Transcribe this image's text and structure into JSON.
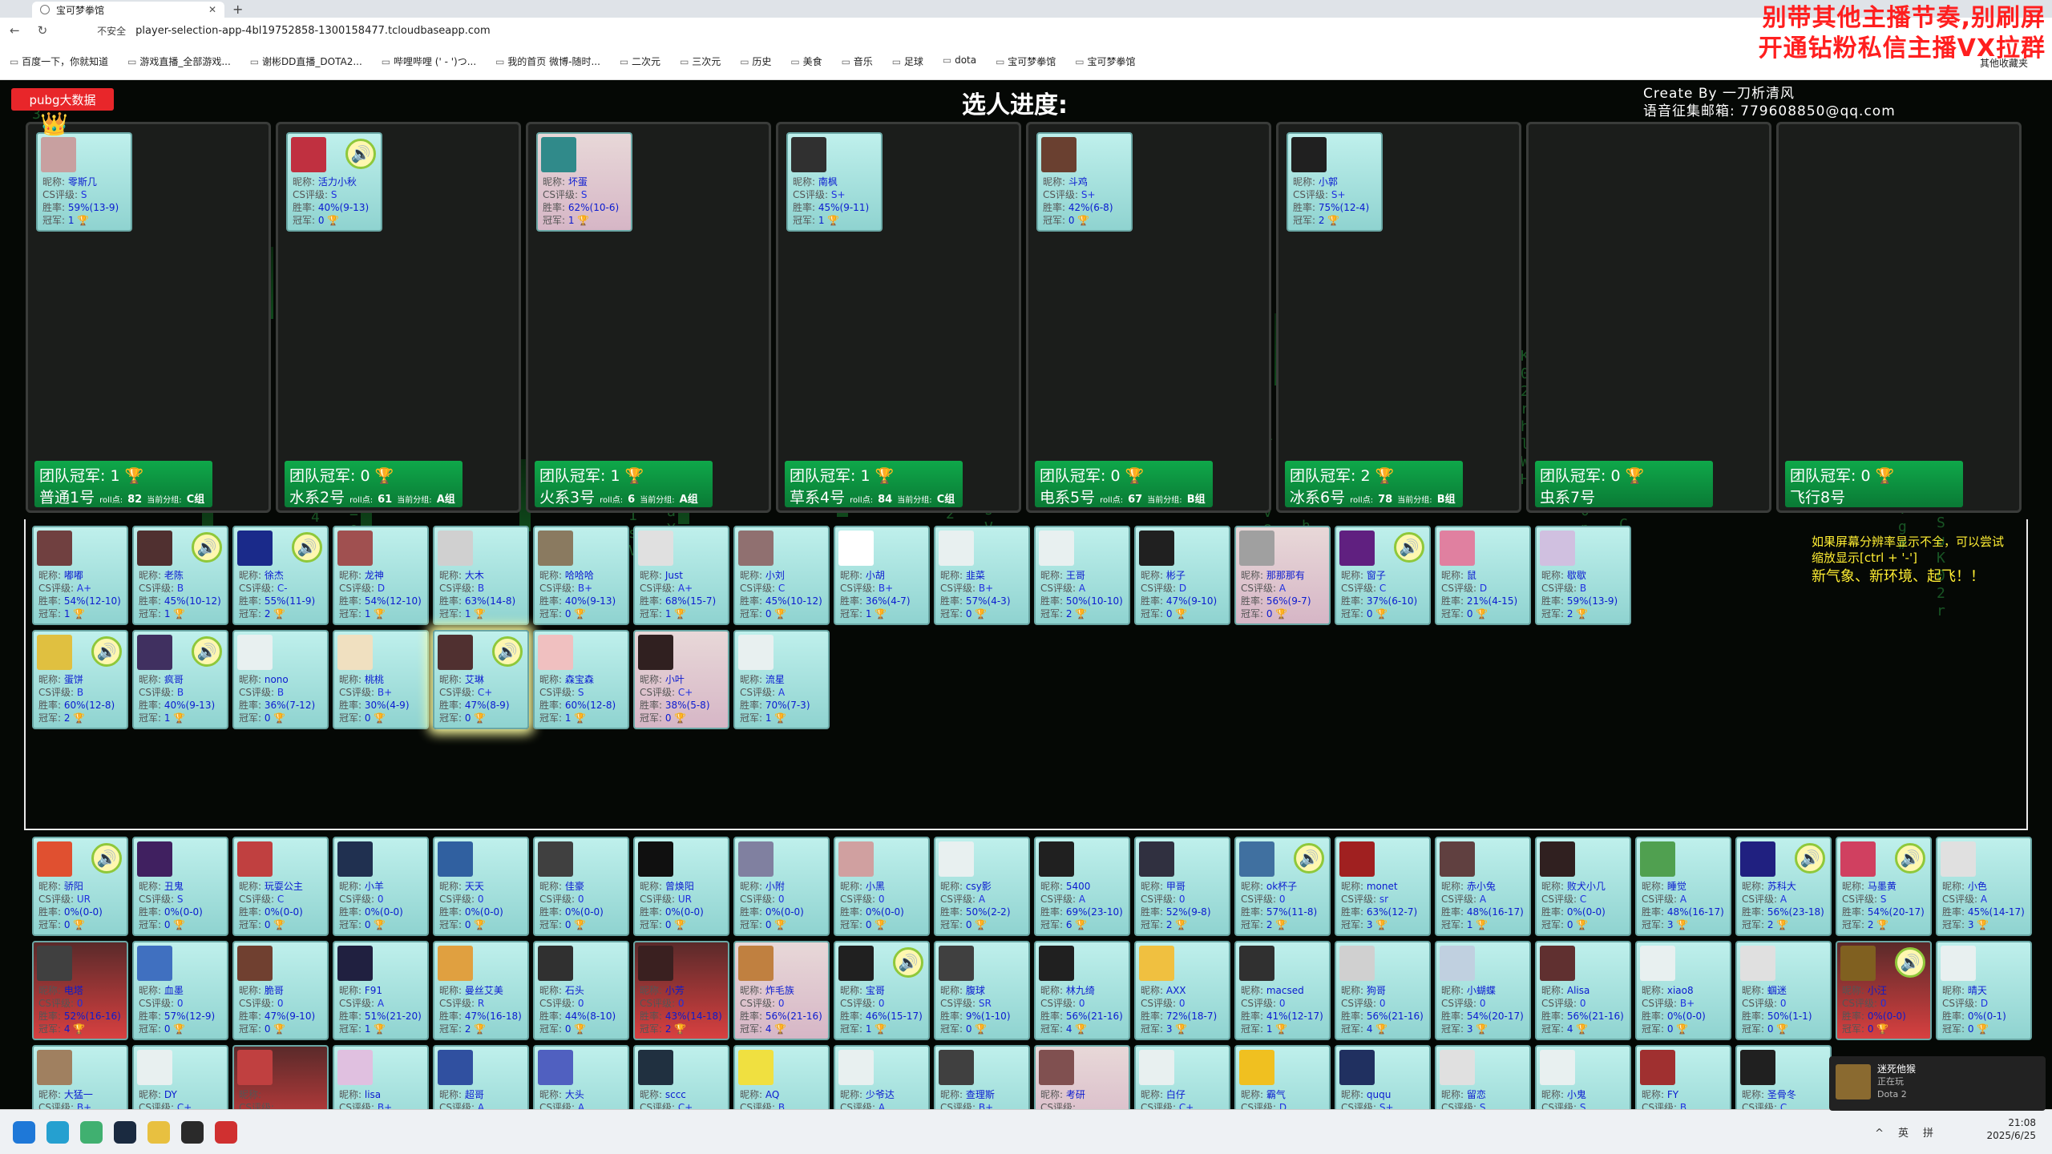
{
  "browser": {
    "tab_title": "宝可梦拳馆",
    "url": "player-selection-app-4bl19752858-1300158477.tcloudbaseapp.com",
    "insecure_label": "不安全",
    "bookmarks": [
      "百度一下，你就知道",
      "游戏直播_全部游戏...",
      "谢彬DD直播_DOTA2...",
      "哔哩哔哩 (' - ')つ...",
      "我的首页 微博-随时...",
      "二次元",
      "三次元",
      "历史",
      "美食",
      "音乐",
      "足球",
      "dota",
      "宝可梦拳馆",
      "宝可梦拳馆"
    ],
    "other_bookmarks": "其他收藏夹"
  },
  "promo": [
    "别带其他主播节奏,别刷屏",
    "开通钻粉私信主播VX拉群"
  ],
  "header": {
    "pubg_button": "pubg大数据",
    "progress_title": "选人进度:",
    "credit_line1": "Create By 一刀析清风",
    "credit_line2": "语音征集邮箱: 779608850@qq.com"
  },
  "labels": {
    "nick": "昵称: ",
    "cs": "CS评级: ",
    "win": "胜率: ",
    "crown": "冠军: "
  },
  "teams": [
    {
      "champ": "团队冠军: 1",
      "name": "普通1号",
      "roll": "roll点:",
      "rollv": "82",
      "score": "当前分组:",
      "group": "C组",
      "members": [
        {
          "nick": "零斯几",
          "cs": "S",
          "win": "59%(13-9)",
          "crown": "1",
          "c": "#c8a0a0"
        }
      ]
    },
    {
      "champ": "团队冠军: 0",
      "name": "水系2号",
      "roll": "roll点:",
      "rollv": "61",
      "score": "当前分组:",
      "group": "A组",
      "members": [
        {
          "nick": "活力小秋",
          "cs": "S",
          "win": "40%(9-13)",
          "crown": "0",
          "c": "#c03040",
          "spk": true
        }
      ]
    },
    {
      "champ": "团队冠军: 1",
      "name": "火系3号",
      "roll": "roll点:",
      "rollv": "6",
      "score": "当前分组:",
      "group": "A组",
      "members": [
        {
          "nick": "坏蛋",
          "cs": "S",
          "win": "62%(10-6)",
          "crown": "1",
          "c": "#308a8a",
          "pink": true
        }
      ]
    },
    {
      "champ": "团队冠军: 1",
      "name": "草系4号",
      "roll": "roll点:",
      "rollv": "84",
      "score": "当前分组:",
      "group": "C组",
      "members": [
        {
          "nick": "南枫",
          "cs": "S+",
          "win": "45%(9-11)",
          "crown": "1",
          "c": "#303030"
        }
      ]
    },
    {
      "champ": "团队冠军: 0",
      "name": "电系5号",
      "roll": "roll点:",
      "rollv": "67",
      "score": "当前分组:",
      "group": "B组",
      "members": [
        {
          "nick": "斗鸡",
          "cs": "S+",
          "win": "42%(6-8)",
          "crown": "0",
          "c": "#6a4030"
        }
      ]
    },
    {
      "champ": "团队冠军: 2",
      "name": "冰系6号",
      "roll": "roll点:",
      "rollv": "78",
      "score": "当前分组:",
      "group": "B组",
      "members": [
        {
          "nick": "小郭",
          "cs": "S+",
          "win": "75%(12-4)",
          "crown": "2",
          "c": "#202020"
        }
      ]
    },
    {
      "champ": "团队冠军: 0",
      "name": "虫系7号",
      "members": []
    },
    {
      "champ": "团队冠军: 0",
      "name": "飞行8号",
      "members": []
    }
  ],
  "pool": [
    {
      "nick": "嘟嘟",
      "cs": "A+",
      "win": "54%(12-10)",
      "crown": "1",
      "c": "#704040"
    },
    {
      "nick": "老陈",
      "cs": "B",
      "win": "45%(10-12)",
      "crown": "1",
      "c": "#503030",
      "spk": true
    },
    {
      "nick": "徐杰",
      "cs": "C-",
      "win": "55%(11-9)",
      "crown": "2",
      "c": "#1a2a8a",
      "spk": true
    },
    {
      "nick": "龙神",
      "cs": "D",
      "win": "54%(12-10)",
      "crown": "1",
      "c": "#a05050"
    },
    {
      "nick": "大木",
      "cs": "B",
      "win": "63%(14-8)",
      "crown": "1",
      "c": "#d0d0d0"
    },
    {
      "nick": "哈哈哈",
      "cs": "B+",
      "win": "40%(9-13)",
      "crown": "0",
      "c": "#8a7a60"
    },
    {
      "nick": "Just",
      "cs": "A+",
      "win": "68%(15-7)",
      "crown": "1",
      "c": "#e0e0e0"
    },
    {
      "nick": "小刘",
      "cs": "C",
      "win": "45%(10-12)",
      "crown": "0",
      "c": "#907070"
    },
    {
      "nick": "小胡",
      "cs": "B+",
      "win": "36%(4-7)",
      "crown": "1",
      "c": "#ffffff"
    },
    {
      "nick": "韭菜",
      "cs": "B+",
      "win": "57%(4-3)",
      "crown": "0",
      "c": "#e8f0f0"
    },
    {
      "nick": "王哥",
      "cs": "A",
      "win": "50%(10-10)",
      "crown": "2",
      "c": "#e8f0f0"
    },
    {
      "nick": "彬子",
      "cs": "D",
      "win": "47%(9-10)",
      "crown": "0",
      "c": "#202020"
    },
    {
      "nick": "那那那有",
      "cs": "A",
      "win": "56%(9-7)",
      "crown": "0",
      "c": "#a0a0a0",
      "pink": true
    },
    {
      "nick": "窗子",
      "cs": "C",
      "win": "37%(6-10)",
      "crown": "0",
      "c": "#602080",
      "spk": true
    },
    {
      "nick": "鼠",
      "cs": "D",
      "win": "21%(4-15)",
      "crown": "0",
      "c": "#e080a0"
    },
    {
      "nick": "歇歇",
      "cs": "B",
      "win": "59%(13-9)",
      "crown": "2",
      "c": "#d0c0e0"
    },
    {
      "nick": "蛋饼",
      "cs": "B",
      "win": "60%(12-8)",
      "crown": "2",
      "c": "#e0c040",
      "spk": true
    },
    {
      "nick": "疯哥",
      "cs": "B",
      "win": "40%(9-13)",
      "crown": "1",
      "c": "#403060",
      "spk": true
    },
    {
      "nick": "nono",
      "cs": "B",
      "win": "36%(7-12)",
      "crown": "0",
      "c": "#e8f0f0"
    },
    {
      "nick": "桃桃",
      "cs": "B+",
      "win": "30%(4-9)",
      "crown": "0",
      "c": "#f0e0c0"
    },
    {
      "nick": "艾琳",
      "cs": "C+",
      "win": "47%(8-9)",
      "crown": "0",
      "c": "#503030",
      "spk": true,
      "glow": true
    },
    {
      "nick": "森宝森",
      "cs": "S",
      "win": "60%(12-8)",
      "crown": "1",
      "c": "#f0c0c0"
    },
    {
      "nick": "小叶",
      "cs": "C+",
      "win": "38%(5-8)",
      "crown": "0",
      "c": "#302020",
      "pink": true
    },
    {
      "nick": "流星",
      "cs": "A",
      "win": "70%(7-3)",
      "crown": "1",
      "c": "#e8f0f0"
    }
  ],
  "bottom": [
    {
      "nick": "骄阳",
      "cs": "UR",
      "win": "0%(0-0)",
      "crown": "0",
      "c": "#e05030",
      "spk": true
    },
    {
      "nick": "丑鬼",
      "cs": "S",
      "win": "0%(0-0)",
      "crown": "0",
      "c": "#402060"
    },
    {
      "nick": "玩耍公主",
      "cs": "C",
      "win": "0%(0-0)",
      "crown": "0",
      "c": "#c04040"
    },
    {
      "nick": "小羊",
      "cs": "0",
      "win": "0%(0-0)",
      "crown": "0",
      "c": "#203050"
    },
    {
      "nick": "天天",
      "cs": "0",
      "win": "0%(0-0)",
      "crown": "0",
      "c": "#3060a0"
    },
    {
      "nick": "佳豪",
      "cs": "0",
      "win": "0%(0-0)",
      "crown": "0",
      "c": "#404040"
    },
    {
      "nick": "曾焕阳",
      "cs": "UR",
      "win": "0%(0-0)",
      "crown": "0",
      "c": "#101010"
    },
    {
      "nick": "小附",
      "cs": "0",
      "win": "0%(0-0)",
      "crown": "0",
      "c": "#8080a0"
    },
    {
      "nick": "小黑",
      "cs": "0",
      "win": "0%(0-0)",
      "crown": "0",
      "c": "#d0a0a0"
    },
    {
      "nick": "csy影",
      "cs": "A",
      "win": "50%(2-2)",
      "crown": "0",
      "c": "#e8f0f0"
    },
    {
      "nick": "5400",
      "cs": "A",
      "win": "69%(23-10)",
      "crown": "6",
      "c": "#202020"
    },
    {
      "nick": "甲哥",
      "cs": "0",
      "win": "52%(9-8)",
      "crown": "2",
      "c": "#303040"
    },
    {
      "nick": "ok杯子",
      "cs": "0",
      "win": "57%(11-8)",
      "crown": "2",
      "c": "#4070a0",
      "spk": true
    },
    {
      "nick": "monet",
      "cs": "sr",
      "win": "63%(12-7)",
      "crown": "3",
      "c": "#a02020"
    },
    {
      "nick": "赤小兔",
      "cs": "A",
      "win": "48%(16-17)",
      "crown": "1",
      "c": "#604040"
    },
    {
      "nick": "败犬小几",
      "cs": "C",
      "win": "0%(0-0)",
      "crown": "0",
      "c": "#302020"
    },
    {
      "nick": "睡觉",
      "cs": "A",
      "win": "48%(16-17)",
      "crown": "3",
      "c": "#50a050"
    },
    {
      "nick": "苏科大",
      "cs": "A",
      "win": "56%(23-18)",
      "crown": "2",
      "c": "#202080",
      "spk": true
    },
    {
      "nick": "马墨黄",
      "cs": "S",
      "win": "54%(20-17)",
      "crown": "2",
      "c": "#d04060",
      "spk": true
    },
    {
      "nick": "小色",
      "cs": "A",
      "win": "45%(14-17)",
      "crown": "3",
      "c": "#e0e0e0"
    },
    {
      "nick": "电塔",
      "cs": "0",
      "win": "52%(16-16)",
      "crown": "4",
      "c": "#404040",
      "dark": true
    },
    {
      "nick": "血墨",
      "cs": "0",
      "win": "57%(12-9)",
      "crown": "0",
      "c": "#4070c0"
    },
    {
      "nick": "脆哥",
      "cs": "0",
      "win": "47%(9-10)",
      "crown": "0",
      "c": "#704030"
    },
    {
      "nick": "F91",
      "cs": "A",
      "win": "51%(21-20)",
      "crown": "1",
      "c": "#202040"
    },
    {
      "nick": "曼丝艾美",
      "cs": "R",
      "win": "47%(16-18)",
      "crown": "2",
      "c": "#e0a040"
    },
    {
      "nick": "石头",
      "cs": "0",
      "win": "44%(8-10)",
      "crown": "0",
      "c": "#303030"
    },
    {
      "nick": "小芳",
      "cs": "0",
      "win": "43%(14-18)",
      "crown": "2",
      "c": "#3a2020",
      "dark": true
    },
    {
      "nick": "炸毛族",
      "cs": "0",
      "win": "56%(21-16)",
      "crown": "4",
      "c": "#c08040",
      "pink": true
    },
    {
      "nick": "宝哥",
      "cs": "0",
      "win": "46%(15-17)",
      "crown": "1",
      "c": "#202020",
      "spk": true
    },
    {
      "nick": "腹球",
      "cs": "SR",
      "win": "9%(1-10)",
      "crown": "0",
      "c": "#404040"
    },
    {
      "nick": "林九绮",
      "cs": "0",
      "win": "56%(21-16)",
      "crown": "4",
      "c": "#202020"
    },
    {
      "nick": "AXX",
      "cs": "0",
      "win": "72%(18-7)",
      "crown": "3",
      "c": "#f0c040"
    },
    {
      "nick": "macsed",
      "cs": "0",
      "win": "41%(12-17)",
      "crown": "1",
      "c": "#303030"
    },
    {
      "nick": "狗哥",
      "cs": "0",
      "win": "56%(21-16)",
      "crown": "4",
      "c": "#d0d0d0"
    },
    {
      "nick": "小蝴蝶",
      "cs": "0",
      "win": "54%(20-17)",
      "crown": "3",
      "c": "#c0d0e0"
    },
    {
      "nick": "Alisa",
      "cs": "0",
      "win": "56%(21-16)",
      "crown": "4",
      "c": "#603030"
    },
    {
      "nick": "xiao8",
      "cs": "B+",
      "win": "0%(0-0)",
      "crown": "0",
      "c": "#e8f0f0"
    },
    {
      "nick": "蝈迷",
      "cs": "0",
      "win": "50%(1-1)",
      "crown": "0",
      "c": "#e0e0e0"
    },
    {
      "nick": "小汪",
      "cs": "0",
      "win": "0%(0-0)",
      "crown": "0",
      "c": "#806020",
      "spk": true,
      "dark": true
    },
    {
      "nick": "晴天",
      "cs": "D",
      "win": "0%(0-1)",
      "crown": "0",
      "c": "#e8f0f0"
    },
    {
      "nick": "大猛一",
      "cs": "B+",
      "win": "",
      "crown": "",
      "c": "#a08060"
    },
    {
      "nick": "DY",
      "cs": "C+",
      "win": "",
      "crown": "",
      "c": "#e8f0f0"
    },
    {
      "nick": "",
      "cs": "",
      "win": "",
      "crown": "",
      "c": "#c04040",
      "dark": true
    },
    {
      "nick": "lisa",
      "cs": "B+",
      "win": "",
      "crown": "",
      "c": "#e0c0e0"
    },
    {
      "nick": "超哥",
      "cs": "A",
      "win": "",
      "crown": "",
      "c": "#3050a0"
    },
    {
      "nick": "大头",
      "cs": "A",
      "win": "",
      "crown": "",
      "c": "#5060c0"
    },
    {
      "nick": "sccc",
      "cs": "C+",
      "win": "",
      "crown": "",
      "c": "#203040"
    },
    {
      "nick": "AQ",
      "cs": "B",
      "win": "",
      "crown": "",
      "c": "#f0e040"
    },
    {
      "nick": "少爷达",
      "cs": "A",
      "win": "",
      "crown": "",
      "c": "#e8f0f0"
    },
    {
      "nick": "查理斯",
      "cs": "B+",
      "win": "",
      "crown": "",
      "c": "#404040"
    },
    {
      "nick": "考研",
      "cs": "",
      "win": "",
      "crown": "",
      "c": "#805050",
      "pink": true
    },
    {
      "nick": "白仔",
      "cs": "C+",
      "win": "",
      "crown": "",
      "c": "#e8f0f0"
    },
    {
      "nick": "霸气",
      "cs": "D",
      "win": "",
      "crown": "",
      "c": "#f0c020"
    },
    {
      "nick": "ququ",
      "cs": "S+",
      "win": "",
      "crown": "",
      "c": "#203060"
    },
    {
      "nick": "留恋",
      "cs": "S",
      "win": "",
      "crown": "",
      "c": "#e0e0e0"
    },
    {
      "nick": "小鬼",
      "cs": "S",
      "win": "",
      "crown": "",
      "c": "#e8f0f0"
    },
    {
      "nick": "FY",
      "cs": "B",
      "win": "",
      "crown": "",
      "c": "#a03030"
    },
    {
      "nick": "圣骨冬",
      "cs": "C",
      "win": "",
      "crown": "",
      "c": "#202020"
    }
  ],
  "hint": {
    "line1": "如果屏幕分辨率显示不全，可以尝试缩放显示[ctrl + '-']",
    "line2": "新气象、新环境、起飞！！"
  },
  "notification": {
    "title": "迷死他猴",
    "status": "正在玩",
    "game": "Dota 2"
  },
  "tray": {
    "ime1": "英",
    "ime2": "拼",
    "time": "21:08",
    "date": "2025/6/25"
  }
}
